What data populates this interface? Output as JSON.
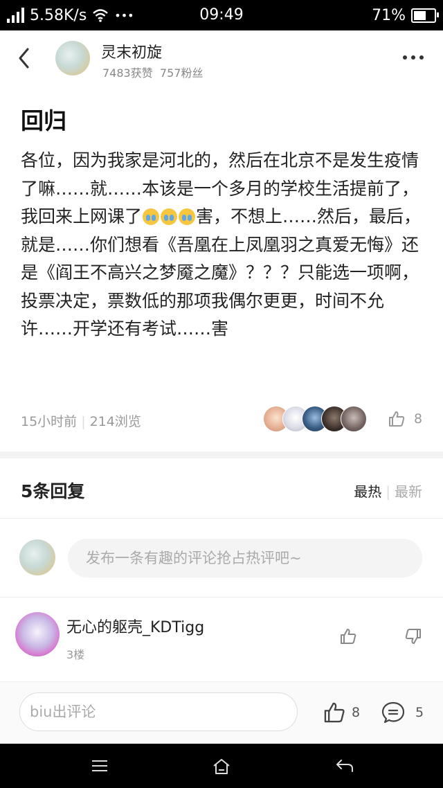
{
  "status": {
    "speed": "5.58K/s",
    "dots": "•••",
    "time": "09:49",
    "battery": "71%",
    "battery_level": 0.71
  },
  "author": {
    "name": "灵末初旋",
    "likes": "7483获赞",
    "fans": "757粉丝"
  },
  "post": {
    "title": "回归",
    "line1": "各位，因为我家是河北的，然后在北京不是发生疫情了嘛……就……本该是一个多月的学校生活提前了，我回来上网课了",
    "line2": "害，不想上……然后，最后，就是……你们想看《吾凰在上凤凰羽之真爱无悔》还是《阎王不高兴之梦魇之魔》？？？只能选一项啊，投票决定，票数低的那项我偶尔更更，时间不允许……开学还有考试……害",
    "time": "15小时前",
    "views": "214浏览",
    "likes": "8"
  },
  "replies": {
    "title": "5条回复",
    "sort_hot": "最热",
    "sort_new": "最新",
    "comment_placeholder": "发布一条有趣的评论抢占热评吧~"
  },
  "comment": {
    "author": "无心的躯壳_KDTigg",
    "floor": "3楼"
  },
  "footer": {
    "input_placeholder": "biu出评论",
    "likes": "8",
    "comments": "5"
  },
  "icons": {
    "back": "back-arrow-icon",
    "more": "more-dots-icon",
    "like": "thumbs-up-icon",
    "dislike": "thumbs-down-icon",
    "comment": "comment-bubble-icon",
    "menu": "menu-lines-icon",
    "home": "home-icon",
    "return": "return-arrow-icon"
  }
}
